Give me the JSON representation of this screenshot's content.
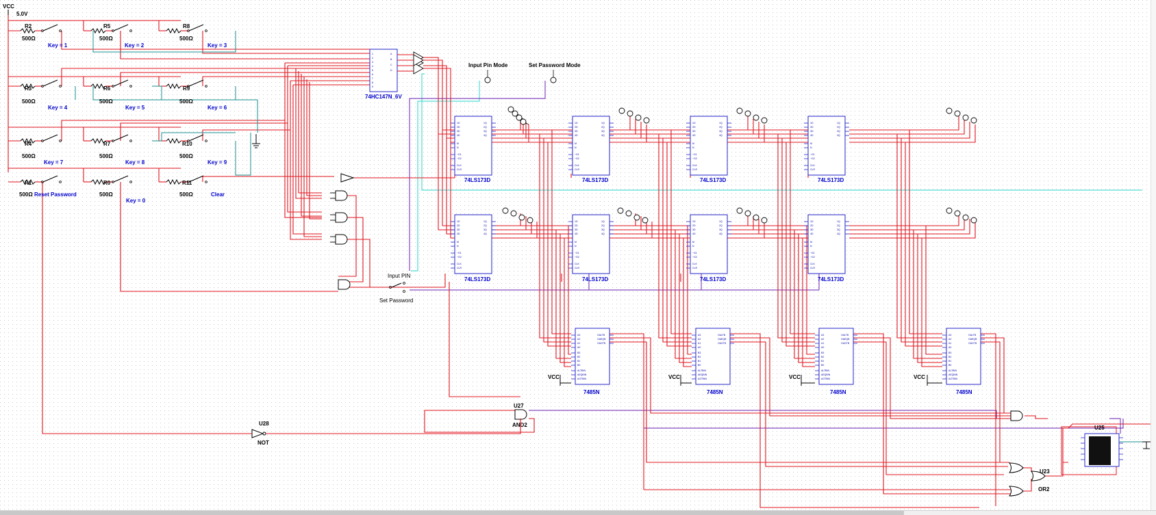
{
  "title_vcc": "VCC",
  "supply_voltage": "5.0V",
  "resistor_value": "500Ω",
  "keypad": [
    {
      "res": "R2",
      "label": "Key = 1"
    },
    {
      "res": "R5",
      "label": "Key = 2"
    },
    {
      "res": "R8",
      "label": "Key = 3"
    },
    {
      "res": "R3",
      "label": "Key = 4"
    },
    {
      "res": "R6",
      "label": "Key = 5"
    },
    {
      "res": "R9",
      "label": "Key = 6"
    },
    {
      "res": "R4",
      "label": "Key = 7"
    },
    {
      "res": "R7",
      "label": "Key = 8"
    },
    {
      "res": "R10",
      "label": "Key = 9"
    },
    {
      "res": "R1",
      "label": "Reset Password"
    },
    {
      "res": "R0",
      "label": "Key = 0"
    },
    {
      "res": "R11",
      "label": "Clear"
    }
  ],
  "encoder": "74HC147N_6V",
  "probes": {
    "input_mode": "Input Pin Mode",
    "set_mode": "Set Password Mode"
  },
  "register": "74LS173D",
  "comparator": "7485N",
  "vcc_short": "VCC",
  "switch": {
    "top": "Input PIN",
    "bottom": "Set Password"
  },
  "gates": {
    "and_ref": "U27",
    "and_type": "AND2",
    "not_ref": "U28",
    "not_type": "NOT",
    "or_ref": "U23",
    "or_type": "OR2",
    "display_ref": "U25"
  },
  "colors": {
    "wire_red": "#e0141e",
    "wire_teal": "#1a8f8f",
    "wire_purple": "#6a22b0",
    "wire_cyan": "#2ad6c8",
    "part_blue": "#2323c8",
    "label_blue": "#0000cc"
  }
}
